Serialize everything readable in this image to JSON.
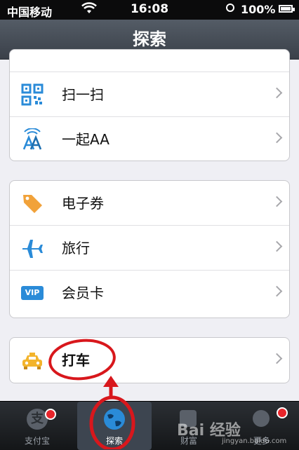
{
  "status_bar": {
    "carrier": "中国移动",
    "time": "16:08",
    "battery": "100%",
    "battery_level": 1.0
  },
  "nav": {
    "title": "探索"
  },
  "group1": {
    "items": [
      {
        "label": "扫一扫",
        "icon": "qr-code-icon"
      },
      {
        "label": "一起AA",
        "icon": "aa-pay-icon"
      }
    ]
  },
  "group2": {
    "items": [
      {
        "label": "电子券",
        "icon": "coupon-tag-icon"
      },
      {
        "label": "旅行",
        "icon": "airplane-icon"
      },
      {
        "label": "会员卡",
        "icon": "vip-card-icon",
        "badge_text": "VIP"
      }
    ]
  },
  "group3": {
    "items": [
      {
        "label": "打车",
        "icon": "taxi-icon"
      }
    ]
  },
  "tabbar": {
    "tabs": [
      {
        "label": "支付宝",
        "icon": "alipay-icon",
        "icon_text": "支"
      },
      {
        "label": "探索",
        "icon": "globe-icon",
        "active": true
      },
      {
        "label": "财富",
        "icon": "wealth-icon"
      },
      {
        "label": "更多",
        "icon": "more-icon"
      }
    ]
  },
  "watermark": {
    "text": "Bai 经验",
    "sub": "jingyan.baidu.com"
  },
  "colors": {
    "nav_bg": "#474e57",
    "annotation_red": "#d8171c",
    "icon_blue": "#2a8bd8",
    "coupon_orange": "#f1a23a",
    "taxi_yellow": "#f3b42c"
  }
}
